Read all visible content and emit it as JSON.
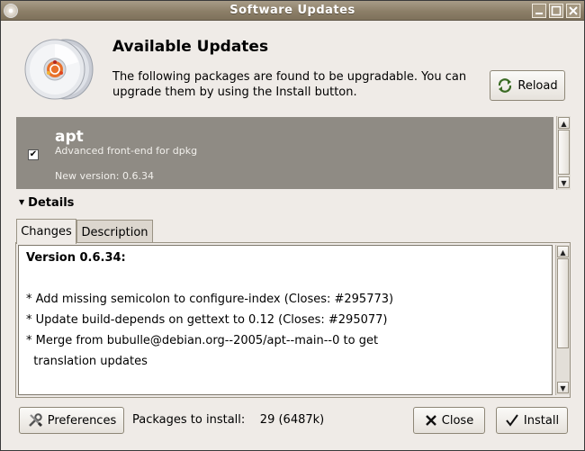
{
  "window": {
    "title": "Software Updates"
  },
  "header": {
    "title": "Available Updates",
    "description": "The following packages are found to be upgradable. You can upgrade them by using the Install button.",
    "reload_label": "Reload"
  },
  "packages": [
    {
      "name": "apt",
      "summary": "Advanced front-end for dpkg",
      "new_version": "New version: 0.6.34",
      "checked": true
    }
  ],
  "details": {
    "label": "Details",
    "tabs": [
      {
        "label": "Changes",
        "active": true
      },
      {
        "label": "Description",
        "active": false
      }
    ],
    "changes": {
      "heading": "Version 0.6.34:",
      "lines": [
        "",
        "* Add missing semicolon to configure-index (Closes: #295773)",
        "* Update build-depends on gettext to 0.12 (Closes: #295077)",
        "* Merge from bubulle@debian.org--2005/apt--main--0 to get",
        "  translation updates"
      ]
    }
  },
  "footer": {
    "preferences_label": "Preferences",
    "packages_label": "Packages to install:",
    "packages_value": "29 (6487k)",
    "close_label": "Close",
    "install_label": "Install"
  }
}
